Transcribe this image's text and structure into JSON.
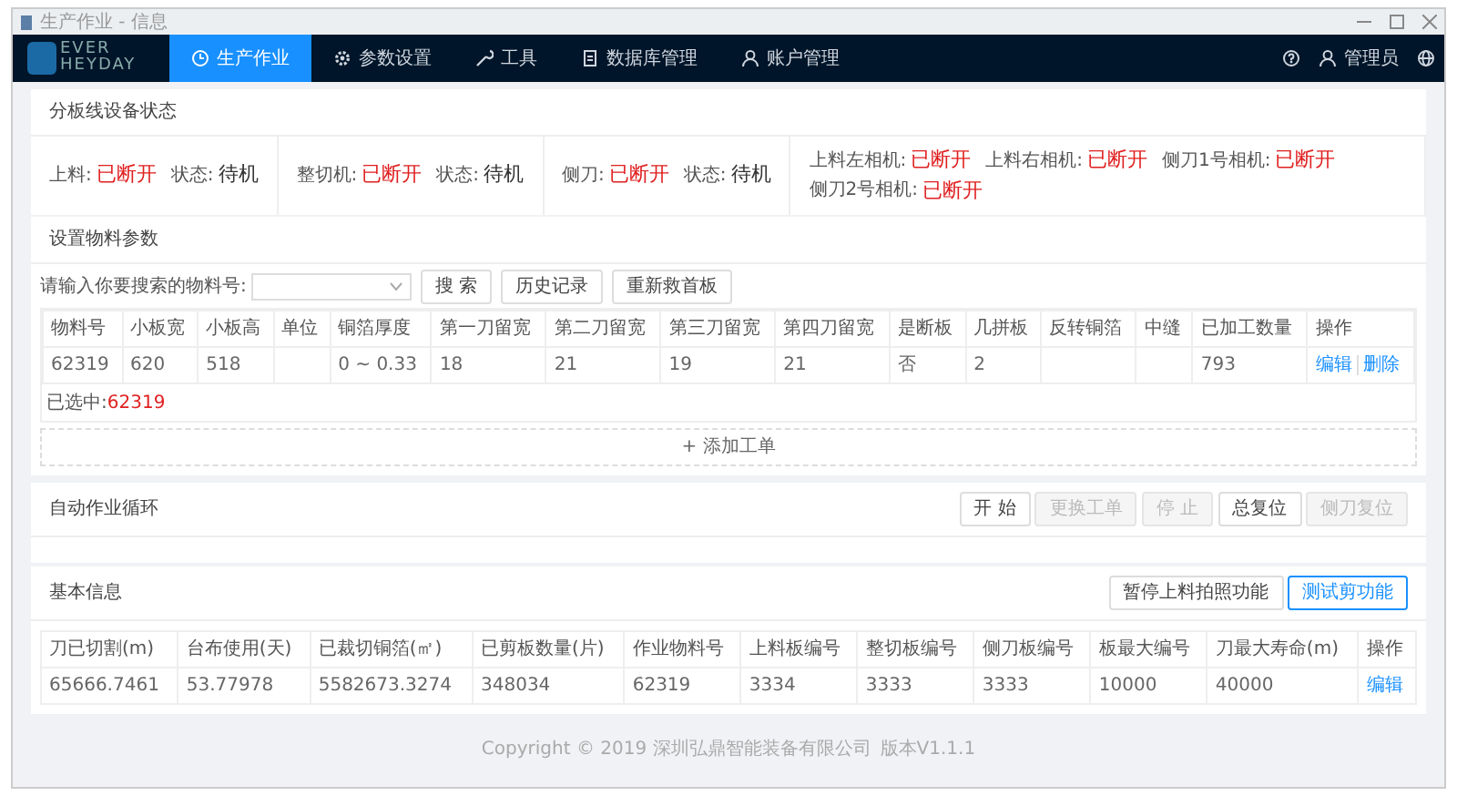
{
  "window": {
    "title": "生产作业 - 信息"
  },
  "navbar": {
    "logo_top": "EVER",
    "logo_bottom": "HEYDAY",
    "items": [
      {
        "label": "生产作业",
        "kind": "clock",
        "selected": true
      },
      {
        "label": "参数设置",
        "kind": "gear",
        "selected": false
      },
      {
        "label": "工具",
        "kind": "wrench",
        "selected": false
      },
      {
        "label": "数据库管理",
        "kind": "doc",
        "selected": false
      },
      {
        "label": "账户管理",
        "kind": "user",
        "selected": false
      }
    ],
    "user": "管理员"
  },
  "device_status": {
    "title": "分板线设备状态",
    "groups": [
      {
        "items": [
          {
            "label": "上料:",
            "value": "已断开",
            "kind": "alert"
          },
          {
            "label": "状态:",
            "value": "待机",
            "kind": "normal"
          }
        ]
      },
      {
        "items": [
          {
            "label": "整切机:",
            "value": "已断开",
            "kind": "alert"
          },
          {
            "label": "状态:",
            "value": "待机",
            "kind": "normal"
          }
        ]
      },
      {
        "items": [
          {
            "label": "侧刀:",
            "value": "已断开",
            "kind": "alert"
          },
          {
            "label": "状态:",
            "value": "待机",
            "kind": "normal"
          }
        ]
      },
      {
        "items": [
          {
            "label": "上料左相机:",
            "value": "已断开",
            "kind": "alert"
          },
          {
            "label": "上料右相机:",
            "value": "已断开",
            "kind": "alert"
          },
          {
            "label": "侧刀1号相机:",
            "value": "已断开",
            "kind": "alert"
          },
          {
            "label": "侧刀2号相机:",
            "value": "已断开",
            "kind": "alert"
          }
        ]
      }
    ]
  },
  "material": {
    "title": "设置物料参数",
    "search_label": "请输入你要搜索的物料号:",
    "buttons": [
      "搜 索",
      "历史记录",
      "重新救首板"
    ],
    "columns": [
      "物料号",
      "小板宽",
      "小板高",
      "单位",
      "铜箔厚度",
      "第一刀留宽",
      "第二刀留宽",
      "第三刀留宽",
      "第四刀留宽",
      "是断板",
      "几拼板",
      "反转铜箔",
      "中缝",
      "已加工数量",
      "操作"
    ],
    "rows": [
      {
        "cells": [
          "62319",
          "620",
          "518",
          "",
          "0 ~ 0.33",
          "18",
          "21",
          "19",
          "21",
          "否",
          "2",
          "",
          "",
          "793"
        ],
        "actions": [
          "编辑",
          "删除"
        ]
      }
    ],
    "selected_label": "已选中:",
    "selected_value": "62319",
    "add_button": "+ 添加工单"
  },
  "auto_cycle": {
    "title": "自动作业循环",
    "buttons": [
      {
        "label": "开 始",
        "disabled": false
      },
      {
        "label": "更换工单",
        "disabled": true
      },
      {
        "label": "停 止",
        "disabled": true
      },
      {
        "label": "总复位",
        "disabled": false
      },
      {
        "label": "侧刀复位",
        "disabled": true
      }
    ]
  },
  "basic_info": {
    "title": "基本信息",
    "buttons": [
      {
        "label": "暂停上料拍照功能",
        "kind": "default"
      },
      {
        "label": "测试剪功能",
        "kind": "primary"
      }
    ],
    "columns": [
      "刀已切割(m)",
      "台布使用(天)",
      "已裁切铜箔(㎡)",
      "已剪板数量(片)",
      "作业物料号",
      "上料板编号",
      "整切板编号",
      "侧刀板编号",
      "板最大编号",
      "刀最大寿命(m)",
      "操作"
    ],
    "rows": [
      {
        "cells": [
          "65666.7461",
          "53.77978",
          "5582673.3274",
          "348034",
          "62319",
          "3334",
          "3333",
          "3333",
          "10000",
          "40000"
        ],
        "actions": [
          "编辑"
        ]
      }
    ]
  },
  "footer": {
    "copyright": "Copyright © 2019 深圳弘鼎智能装备有限公司",
    "version": "版本V1.1.1"
  }
}
